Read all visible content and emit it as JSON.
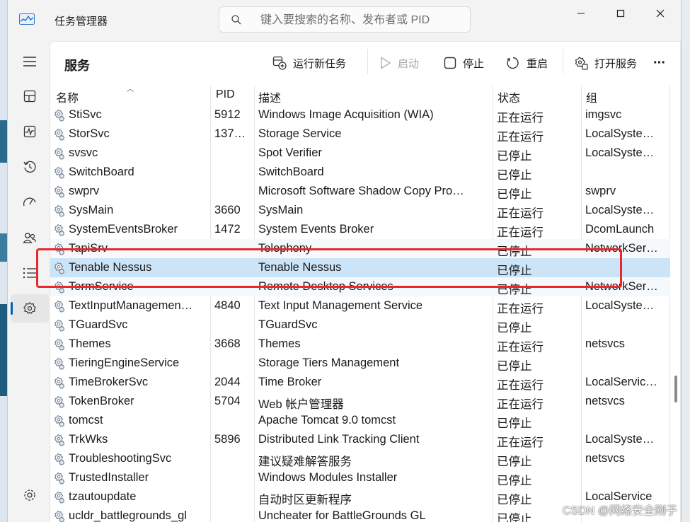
{
  "window": {
    "title": "任务管理器",
    "search_placeholder": "键入要搜索的名称、发布者或 PID",
    "minimize_icon": "minimize-icon",
    "maximize_icon": "maximize-icon",
    "close_icon": "close-icon"
  },
  "sidebar": {
    "items": [
      {
        "name": "hamburger-menu",
        "icon": "hamburger-icon"
      },
      {
        "name": "processes",
        "icon": "processes-icon"
      },
      {
        "name": "performance",
        "icon": "performance-icon"
      },
      {
        "name": "app-history",
        "icon": "history-icon"
      },
      {
        "name": "startup-apps",
        "icon": "startup-icon"
      },
      {
        "name": "users",
        "icon": "users-icon"
      },
      {
        "name": "details",
        "icon": "details-icon"
      },
      {
        "name": "services",
        "icon": "services-icon",
        "active": true
      }
    ],
    "settings_icon": "settings-icon"
  },
  "page": {
    "title": "服务",
    "toolbar": {
      "run_new_task": "运行新任务",
      "start": "启动",
      "stop": "停止",
      "restart": "重启",
      "open_services": "打开服务",
      "more": "···"
    }
  },
  "table": {
    "columns": {
      "name": "名称",
      "pid": "PID",
      "desc": "描述",
      "status": "状态",
      "group": "组"
    },
    "rows": [
      {
        "name": "StiSvc",
        "pid": "5912",
        "desc": "Windows Image Acquisition (WIA)",
        "status": "正在运行",
        "group": "imgsvc"
      },
      {
        "name": "StorSvc",
        "pid": "137…",
        "desc": "Storage Service",
        "status": "正在运行",
        "group": "LocalSyste…"
      },
      {
        "name": "svsvc",
        "pid": "",
        "desc": "Spot Verifier",
        "status": "已停止",
        "group": "LocalSyste…"
      },
      {
        "name": "SwitchBoard",
        "pid": "",
        "desc": "SwitchBoard",
        "status": "已停止",
        "group": ""
      },
      {
        "name": "swprv",
        "pid": "",
        "desc": "Microsoft Software Shadow Copy Pro…",
        "status": "已停止",
        "group": "swprv"
      },
      {
        "name": "SysMain",
        "pid": "3660",
        "desc": "SysMain",
        "status": "正在运行",
        "group": "LocalSyste…"
      },
      {
        "name": "SystemEventsBroker",
        "pid": "1472",
        "desc": "System Events Broker",
        "status": "正在运行",
        "group": "DcomLaunch"
      },
      {
        "name": "TapiSrv",
        "pid": "",
        "desc": "Telephony",
        "status": "已停止",
        "group": "NetworkSer…"
      },
      {
        "name": "Tenable Nessus",
        "pid": "",
        "desc": "Tenable Nessus",
        "status": "已停止",
        "group": "",
        "selected": true
      },
      {
        "name": "TermService",
        "pid": "",
        "desc": "Remote Desktop Services",
        "status": "已停止",
        "group": "NetworkSer…"
      },
      {
        "name": "TextInputManagemen…",
        "pid": "4840",
        "desc": "Text Input Management Service",
        "status": "正在运行",
        "group": "LocalSyste…"
      },
      {
        "name": "TGuardSvc",
        "pid": "",
        "desc": "TGuardSvc",
        "status": "已停止",
        "group": ""
      },
      {
        "name": "Themes",
        "pid": "3668",
        "desc": "Themes",
        "status": "正在运行",
        "group": "netsvcs"
      },
      {
        "name": "TieringEngineService",
        "pid": "",
        "desc": "Storage Tiers Management",
        "status": "已停止",
        "group": ""
      },
      {
        "name": "TimeBrokerSvc",
        "pid": "2044",
        "desc": "Time Broker",
        "status": "正在运行",
        "group": "LocalServic…"
      },
      {
        "name": "TokenBroker",
        "pid": "5704",
        "desc": "Web 帐户管理器",
        "status": "正在运行",
        "group": "netsvcs"
      },
      {
        "name": "tomcst",
        "pid": "",
        "desc": "Apache Tomcat 9.0 tomcst",
        "status": "已停止",
        "group": ""
      },
      {
        "name": "TrkWks",
        "pid": "5896",
        "desc": "Distributed Link Tracking Client",
        "status": "正在运行",
        "group": "LocalSyste…"
      },
      {
        "name": "TroubleshootingSvc",
        "pid": "",
        "desc": "建议疑难解答服务",
        "status": "已停止",
        "group": "netsvcs"
      },
      {
        "name": "TrustedInstaller",
        "pid": "",
        "desc": "Windows Modules Installer",
        "status": "已停止",
        "group": ""
      },
      {
        "name": "tzautoupdate",
        "pid": "",
        "desc": "自动时区更新程序",
        "status": "已停止",
        "group": "LocalService"
      },
      {
        "name": "ucldr_battlegrounds_gl",
        "pid": "",
        "desc": "Uncheater for BattleGrounds GL",
        "status": "已停止",
        "group": ""
      }
    ]
  },
  "watermark": "CSDN @网络安全刚子",
  "colors": {
    "accent": "#005fb8",
    "selected_row": "#cce4f7",
    "annotation_red": "#e8282b"
  }
}
